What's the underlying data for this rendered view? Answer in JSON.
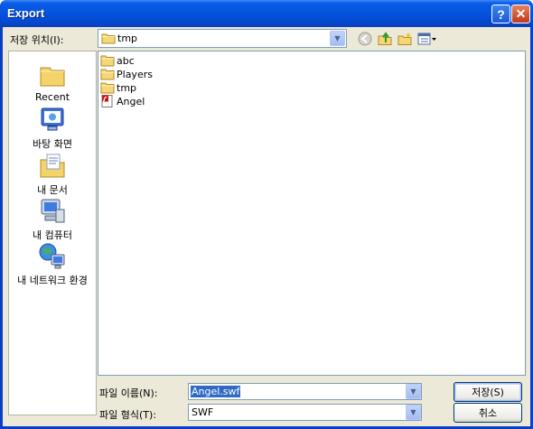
{
  "window": {
    "title": "Export",
    "help_label": "?",
    "close_label": "✕"
  },
  "lookin": {
    "label": "저장 위치(I):",
    "value": "tmp",
    "icon": "folder-icon"
  },
  "toolbar": {
    "icons": [
      "back-icon",
      "up-folder-icon",
      "new-folder-icon",
      "views-menu-icon"
    ]
  },
  "places": [
    {
      "label": "Recent",
      "icon": "recent-icon"
    },
    {
      "label": "바탕 화면",
      "icon": "desktop-icon"
    },
    {
      "label": "내 문서",
      "icon": "my-documents-icon"
    },
    {
      "label": "내 컴퓨터",
      "icon": "my-computer-icon"
    },
    {
      "label": "내 네트워크 환경",
      "icon": "network-icon"
    }
  ],
  "files": [
    {
      "name": "abc",
      "type": "folder"
    },
    {
      "name": "Players",
      "type": "folder"
    },
    {
      "name": "tmp",
      "type": "folder"
    },
    {
      "name": "Angel",
      "type": "swf"
    }
  ],
  "filename": {
    "label": "파일 이름(N):",
    "value": "Angel.swf"
  },
  "filetype": {
    "label": "파일 형식(T):",
    "value": "SWF"
  },
  "buttons": {
    "save": "저장(S)",
    "cancel": "취소"
  },
  "colors": {
    "titlebar": "#0553dd",
    "dialog_bg": "#ece9d8",
    "selection": "#316ac5"
  }
}
